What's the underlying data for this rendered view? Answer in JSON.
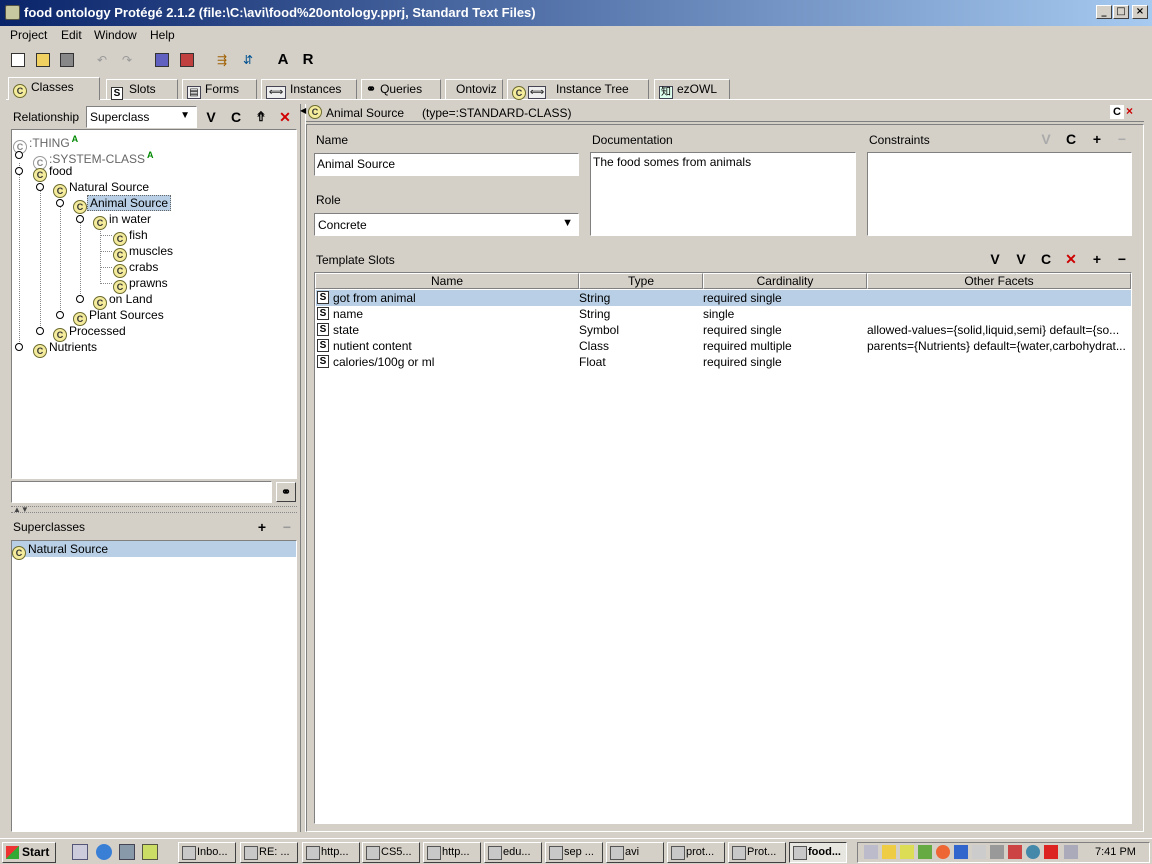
{
  "window": {
    "title": "food ontology  Protégé 2.1.2    (file:\\C:\\avi\\food%20ontology.pprj, Standard Text Files)",
    "minimize": "_",
    "maximize": "□",
    "close": "×"
  },
  "menu": [
    "Project",
    "Edit",
    "Window",
    "Help"
  ],
  "toolbar": {
    "a_label": "A",
    "r_label": "R"
  },
  "tabs": [
    {
      "label": "Classes",
      "icon": "class-icon"
    },
    {
      "label": "Slots",
      "icon": "slot-icon"
    },
    {
      "label": "Forms",
      "icon": "form-icon"
    },
    {
      "label": "Instances",
      "icon": "instance-icon"
    },
    {
      "label": "Queries",
      "icon": "binoculars-icon"
    },
    {
      "label": "Ontoviz",
      "icon": ""
    },
    {
      "label": "Instance Tree",
      "icon": "class-icon"
    },
    {
      "label": "ezOWL",
      "icon": "ezowl-icon"
    }
  ],
  "left": {
    "relationship_label": "Relationship",
    "relationship_value": "Superclass",
    "v_btn": "V",
    "c_btn": "C",
    "tree": [
      {
        "label": ":THING",
        "badge": "A"
      },
      {
        "label": ":SYSTEM-CLASS",
        "badge": "A"
      },
      {
        "label": "food"
      },
      {
        "label": "Natural Source"
      },
      {
        "label": "Animal Source"
      },
      {
        "label": "in water"
      },
      {
        "label": "fish"
      },
      {
        "label": "muscles"
      },
      {
        "label": "crabs"
      },
      {
        "label": "prawns"
      },
      {
        "label": "on Land"
      },
      {
        "label": "Plant Sources"
      },
      {
        "label": "Processed"
      },
      {
        "label": "Nutrients"
      }
    ],
    "search_value": "",
    "superclasses_label": "Superclasses",
    "superclasses": [
      "Natural Source"
    ],
    "plus": "+",
    "minus": "−"
  },
  "right": {
    "header_class": "Animal Source",
    "header_type": "(type=:STANDARD-CLASS)",
    "header_btn": "C",
    "name_label": "Name",
    "name_value": "Animal Source",
    "role_label": "Role",
    "role_value": "Concrete",
    "doc_label": "Documentation",
    "doc_value": "The food somes from animals",
    "constraints_label": "Constraints",
    "template_slots_label": "Template Slots",
    "columns": [
      "Name",
      "Type",
      "Cardinality",
      "Other Facets"
    ],
    "slots": [
      {
        "name": "got from animal",
        "type": "String",
        "cardinality": "required single",
        "facets": ""
      },
      {
        "name": "name",
        "type": "String",
        "cardinality": "single",
        "facets": ""
      },
      {
        "name": "state",
        "type": "Symbol",
        "cardinality": "required single",
        "facets": "allowed-values={solid,liquid,semi} default={so..."
      },
      {
        "name": "nutient content",
        "type": "Class",
        "cardinality": "required multiple",
        "facets": "parents={Nutrients} default={water,carbohydrat..."
      },
      {
        "name": "calories/100g or ml",
        "type": "Float",
        "cardinality": "required single",
        "facets": ""
      }
    ]
  },
  "taskbar": {
    "start": "Start",
    "tasks": [
      "Inbo...",
      "RE: ...",
      "http...",
      "CS5...",
      "http...",
      "edu...",
      "sep ...",
      "avi",
      "prot...",
      "Prot...",
      "food..."
    ],
    "clock": "7:41 PM"
  }
}
